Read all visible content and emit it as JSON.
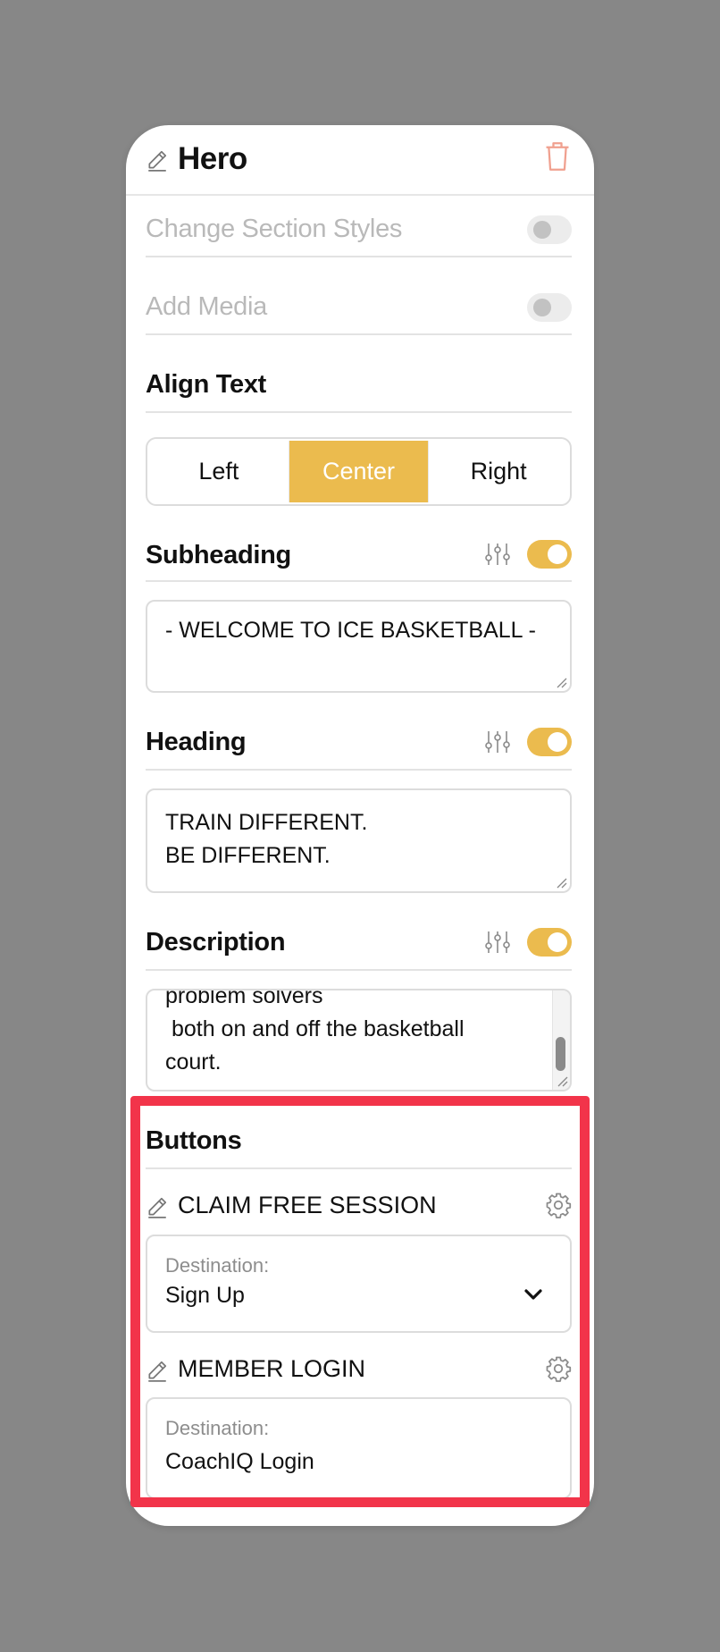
{
  "panel": {
    "title": "Hero",
    "change_section_styles": "Change Section Styles",
    "add_media": "Add Media",
    "align_text": {
      "label": "Align Text",
      "options": [
        "Left",
        "Center",
        "Right"
      ],
      "selected": "Center"
    },
    "subheading": {
      "label": "Subheading",
      "enabled": true,
      "value": "- WELCOME TO ICE BASKETBALL -"
    },
    "heading": {
      "label": "Heading",
      "enabled": true,
      "lines": [
        "TRAIN DIFFERENT.",
        "BE DIFFERENT."
      ]
    },
    "description": {
      "label": "Description",
      "enabled": true,
      "visible_lines": [
        "problem solvers",
        " both on and off the basketball",
        "court."
      ]
    },
    "buttons": {
      "label": "Buttons",
      "items": [
        {
          "name": "CLAIM FREE SESSION",
          "destination_label": "Destination:",
          "destination": "Sign Up"
        },
        {
          "name": "MEMBER LOGIN",
          "destination_label": "Destination:",
          "destination": "CoachIQ Login"
        }
      ]
    }
  },
  "colors": {
    "accent": "#ebbb4e",
    "highlight": "#f2344a",
    "backdrop": "#878787",
    "delete": "#f0a08f"
  },
  "icons": {
    "title_edit": "pencil-icon",
    "delete": "trash-icon",
    "style_settings": "sliders-icon",
    "button_settings": "gear-icon",
    "dropdown": "chevron-down-icon"
  }
}
